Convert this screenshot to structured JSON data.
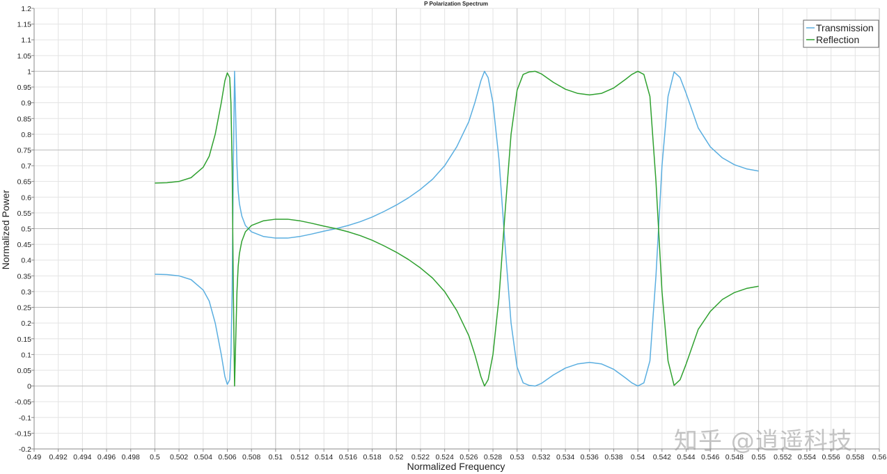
{
  "chart_data": {
    "type": "line",
    "title": "P Polarization Spectrum",
    "xlabel": "Normalized Frequency",
    "ylabel": "Normalized Power",
    "xlim": [
      0.49,
      0.56
    ],
    "ylim": [
      -0.2,
      1.2
    ],
    "x_ticks": [
      "0.49",
      "0.492",
      "0.494",
      "0.496",
      "0.498",
      "0.5",
      "0.502",
      "0.504",
      "0.506",
      "0.508",
      "0.51",
      "0.512",
      "0.514",
      "0.516",
      "0.518",
      "0.52",
      "0.522",
      "0.524",
      "0.526",
      "0.528",
      "0.53",
      "0.532",
      "0.534",
      "0.536",
      "0.538",
      "0.54",
      "0.542",
      "0.544",
      "0.546",
      "0.548",
      "0.55",
      "0.552",
      "0.554",
      "0.556",
      "0.558",
      "0.56"
    ],
    "y_ticks": [
      "-0.2",
      "-0.15",
      "-0.1",
      "-0.05",
      "0",
      "0.05",
      "0.1",
      "0.15",
      "0.2",
      "0.25",
      "0.3",
      "0.35",
      "0.4",
      "0.45",
      "0.5",
      "0.55",
      "0.6",
      "0.65",
      "0.7",
      "0.75",
      "0.8",
      "0.85",
      "0.9",
      "0.95",
      "1",
      "1.05",
      "1.1",
      "1.15",
      "1.2"
    ],
    "grid": true,
    "legend_position": "top-right",
    "series": [
      {
        "name": "Transmission",
        "color": "#5aaee0",
        "x": [
          0.5,
          0.501,
          0.502,
          0.503,
          0.504,
          0.5045,
          0.505,
          0.5055,
          0.5058,
          0.506,
          0.5062,
          0.5063,
          0.5064,
          0.5065,
          0.5066,
          0.5067,
          0.5068,
          0.5069,
          0.507,
          0.5072,
          0.5075,
          0.508,
          0.509,
          0.51,
          0.511,
          0.512,
          0.513,
          0.514,
          0.515,
          0.516,
          0.517,
          0.518,
          0.519,
          0.52,
          0.521,
          0.522,
          0.523,
          0.524,
          0.525,
          0.526,
          0.5265,
          0.527,
          0.5273,
          0.5276,
          0.528,
          0.5285,
          0.529,
          0.5295,
          0.53,
          0.5305,
          0.531,
          0.5315,
          0.532,
          0.533,
          0.534,
          0.535,
          0.536,
          0.537,
          0.538,
          0.539,
          0.5395,
          0.54,
          0.5405,
          0.541,
          0.5415,
          0.542,
          0.5425,
          0.543,
          0.5435,
          0.544,
          0.545,
          0.546,
          0.547,
          0.548,
          0.549,
          0.55
        ],
        "y": [
          0.355,
          0.354,
          0.35,
          0.338,
          0.305,
          0.27,
          0.2,
          0.1,
          0.03,
          0.005,
          0.02,
          0.1,
          0.3,
          0.7,
          1.0,
          0.85,
          0.7,
          0.62,
          0.58,
          0.54,
          0.51,
          0.49,
          0.475,
          0.47,
          0.47,
          0.475,
          0.483,
          0.492,
          0.5,
          0.51,
          0.522,
          0.537,
          0.555,
          0.575,
          0.598,
          0.625,
          0.657,
          0.7,
          0.76,
          0.84,
          0.9,
          0.97,
          1.0,
          0.98,
          0.9,
          0.72,
          0.45,
          0.2,
          0.06,
          0.01,
          0.002,
          0.0,
          0.008,
          0.035,
          0.057,
          0.07,
          0.075,
          0.07,
          0.053,
          0.025,
          0.01,
          0.0,
          0.01,
          0.08,
          0.35,
          0.7,
          0.92,
          0.998,
          0.98,
          0.93,
          0.82,
          0.76,
          0.725,
          0.703,
          0.69,
          0.683
        ]
      },
      {
        "name": "Reflection",
        "color": "#2ea02e",
        "x": [
          0.5,
          0.501,
          0.502,
          0.503,
          0.504,
          0.5045,
          0.505,
          0.5055,
          0.5058,
          0.506,
          0.5062,
          0.5063,
          0.5064,
          0.5065,
          0.5066,
          0.5067,
          0.5068,
          0.5069,
          0.507,
          0.5072,
          0.5075,
          0.508,
          0.509,
          0.51,
          0.511,
          0.512,
          0.513,
          0.514,
          0.515,
          0.516,
          0.517,
          0.518,
          0.519,
          0.52,
          0.521,
          0.522,
          0.523,
          0.524,
          0.525,
          0.526,
          0.5265,
          0.527,
          0.5273,
          0.5276,
          0.528,
          0.5285,
          0.529,
          0.5295,
          0.53,
          0.5305,
          0.531,
          0.5315,
          0.532,
          0.533,
          0.534,
          0.535,
          0.536,
          0.537,
          0.538,
          0.539,
          0.5395,
          0.54,
          0.5405,
          0.541,
          0.5415,
          0.542,
          0.5425,
          0.543,
          0.5435,
          0.544,
          0.545,
          0.546,
          0.547,
          0.548,
          0.549,
          0.55
        ],
        "y": [
          0.645,
          0.646,
          0.65,
          0.662,
          0.695,
          0.73,
          0.8,
          0.9,
          0.97,
          0.995,
          0.98,
          0.9,
          0.7,
          0.3,
          0.0,
          0.15,
          0.3,
          0.38,
          0.42,
          0.46,
          0.49,
          0.51,
          0.525,
          0.53,
          0.53,
          0.525,
          0.517,
          0.508,
          0.5,
          0.49,
          0.478,
          0.463,
          0.445,
          0.425,
          0.402,
          0.375,
          0.343,
          0.3,
          0.24,
          0.16,
          0.1,
          0.03,
          0.0,
          0.02,
          0.1,
          0.28,
          0.55,
          0.8,
          0.94,
          0.99,
          0.998,
          1.0,
          0.992,
          0.965,
          0.943,
          0.93,
          0.925,
          0.93,
          0.947,
          0.975,
          0.99,
          1.0,
          0.99,
          0.92,
          0.65,
          0.3,
          0.08,
          0.002,
          0.02,
          0.07,
          0.18,
          0.237,
          0.275,
          0.297,
          0.31,
          0.317
        ]
      }
    ]
  },
  "watermark": "知乎 @逍遥科技"
}
